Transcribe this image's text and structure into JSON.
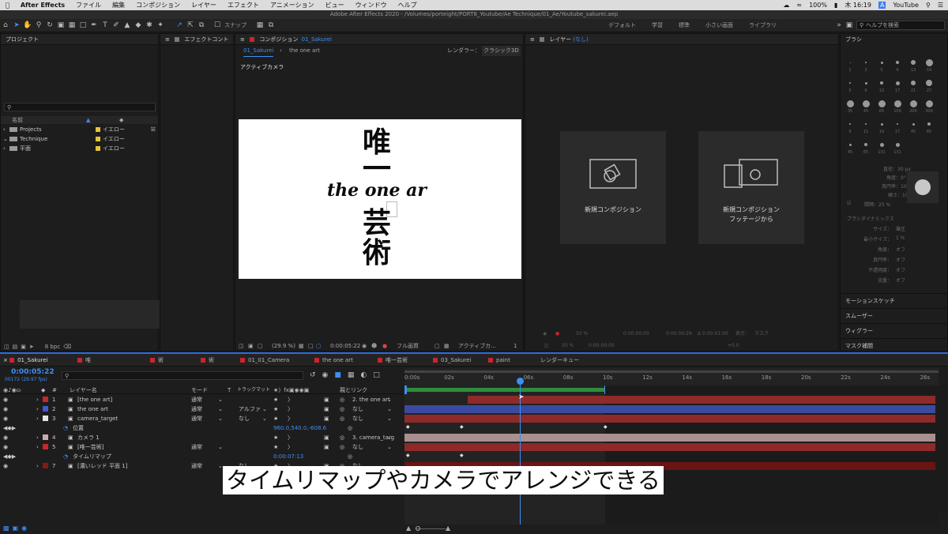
{
  "menubar": {
    "app": "After Effects",
    "items": [
      "ファイル",
      "編集",
      "コンポジション",
      "レイヤー",
      "エフェクト",
      "アニメーション",
      "ビュー",
      "ウィンドウ",
      "ヘルプ"
    ],
    "battery": "100%",
    "clock": "木 16:19",
    "account": "YouTube"
  },
  "window_title": "Adobe After Effects 2020 - /Volumes/porteight/PORT8_Youtube/Ae Technique/01_Ae/Youtube_sakurei.aep",
  "toolbar": {
    "snap_label": "スナップ",
    "workspaces": [
      "デフォルト",
      "学習",
      "標準",
      "小さい画面",
      "ライブラリ"
    ],
    "search_placeholder": "ヘルプを検索"
  },
  "project": {
    "title": "プロジェクト",
    "col_name": "名前",
    "items": [
      {
        "name": "Projects",
        "label": "イエロー"
      },
      {
        "name": "Technique",
        "label": "イエロー"
      },
      {
        "name": "平面",
        "label": "イエロー"
      }
    ],
    "bpc": "8 bpc"
  },
  "effects": {
    "title": "エフェクトコント"
  },
  "comp": {
    "title": "コンポジション",
    "title_name": "01_Sakurei",
    "crumb1": "01_Sakurei",
    "crumb2": "the one art",
    "renderer_label": "レンダラー：",
    "renderer_value": "クラシック3D",
    "camera_label": "アクティブカメラ",
    "zoom": "(29.9 %)",
    "timecode": "0:00:05:22",
    "quality": "フル画質",
    "view": "アクティブカ...",
    "view_count": "1 画",
    "art_line1": "唯",
    "art_line2": "一",
    "art_script": "the one ar",
    "art_line3": "芸",
    "art_line4": "術"
  },
  "layer_panel": {
    "title": "レイヤー",
    "title_state": "(なし)",
    "new_comp": "新規コンポジション",
    "new_comp_footage_1": "新規コンポジション",
    "new_comp_footage_2": "フッテージから",
    "bottom_zoom": "50 %",
    "bottom_tc1": "0:00:00:00",
    "bottom_tc2": "0:00:00:29",
    "bottom_tc3": "Δ 0:00:01:00",
    "bottom_view": "表示：",
    "bottom_mask": "マスク",
    "bottom_offset": "+0.0"
  },
  "brush": {
    "title": "ブラシ",
    "sizes": [
      "1",
      "3",
      "5",
      "9",
      "13",
      "19",
      "5",
      "9",
      "13",
      "17",
      "21",
      "27",
      "35",
      "45",
      "65",
      "100",
      "200",
      "300",
      "9",
      "11",
      "19",
      "17",
      "45",
      "65",
      "45",
      "65",
      "131",
      "131"
    ],
    "diameter": "直径：30 px",
    "angle": "角度：0°",
    "roundness": "真円率：100 %",
    "hardness": "硬さ：100 %",
    "spacing": "間隔：25 %",
    "dynamics_title": "ブラシダイナミックス",
    "dyn": [
      {
        "k": "サイズ：",
        "v": "筆圧"
      },
      {
        "k": "最小サイズ：",
        "v": "1 %"
      },
      {
        "k": "角度：",
        "v": "オフ"
      },
      {
        "k": "真円率：",
        "v": "オフ"
      },
      {
        "k": "不透明度：",
        "v": "オフ"
      },
      {
        "k": "流量：",
        "v": "オフ"
      }
    ],
    "sections": [
      "モーションスケッチ",
      "スムーザー",
      "ウィグラー",
      "マスク補間"
    ]
  },
  "timeline": {
    "tabs": [
      "01_Sakurei",
      "唯",
      "術",
      "術",
      "01_01_Camera",
      "the one art",
      "唯一芸術",
      "03_Sakurei",
      "paint",
      "レンダーキュー"
    ],
    "tab_colors": [
      "#c9262c",
      "#c9262c",
      "#c9262c",
      "#c9262c",
      "#c9262c",
      "#c9262c",
      "#c9262c",
      "#c9262c",
      "#c9262c",
      "#c9262c"
    ],
    "timecode": "0:00:05:22",
    "timecode_sub": "00172 (29.97 fps)",
    "headers": {
      "name": "レイヤー名",
      "mode": "モード",
      "t": "T",
      "trkmat": "トラックマット",
      "parent": "親とリンク"
    },
    "layers": [
      {
        "num": "1",
        "name": "[the one art]",
        "mode": "通常",
        "trk": "",
        "parent": "2. the one art",
        "color": "#c9262c"
      },
      {
        "num": "2",
        "name": "the one art",
        "mode": "通常",
        "trk": "アルファ",
        "parent": "なし",
        "color": "#3e5ccb"
      },
      {
        "num": "3",
        "name": "camera_target",
        "mode": "通常",
        "trk": "なし",
        "parent": "なし",
        "color": "#e6e6e6"
      },
      {
        "num": "",
        "name": "位置",
        "value": "960.0,540.0,-608.6"
      },
      {
        "num": "4",
        "name": "カメラ 1",
        "mode": "",
        "trk": "",
        "parent": "3. camera_targ",
        "color": "#d2a9a9"
      },
      {
        "num": "5",
        "name": "[唯一芸術]",
        "mode": "通常",
        "trk": "",
        "parent": "なし",
        "color": "#c9262c"
      },
      {
        "num": "",
        "name": "タイムリマップ",
        "value": "0:00:07:13"
      },
      {
        "num": "7",
        "name": "[濃いレッド 平面 1]",
        "mode": "通常",
        "trk": "なし",
        "parent": "なし",
        "color": "#8a1717"
      }
    ],
    "ruler": [
      "0:00s",
      "02s",
      "04s",
      "06s",
      "08s",
      "10s",
      "12s",
      "14s",
      "16s",
      "18s",
      "20s",
      "22s",
      "24s",
      "26s"
    ],
    "subtitle": "タイムリマップやカメラでアレンジできる"
  }
}
